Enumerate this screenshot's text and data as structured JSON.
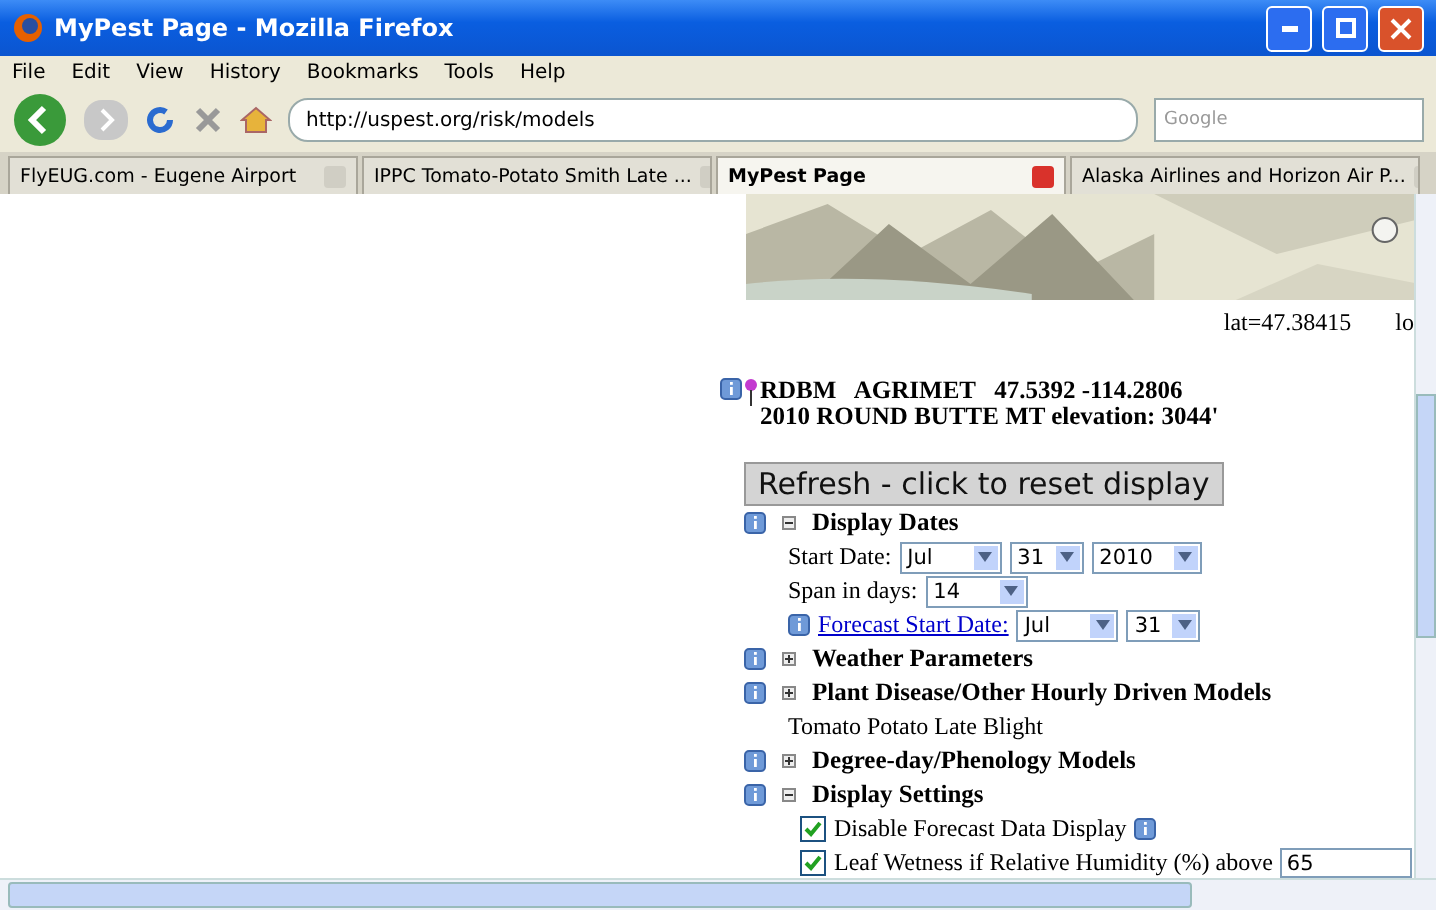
{
  "window": {
    "title": "MyPest Page - Mozilla Firefox"
  },
  "menu": [
    "File",
    "Edit",
    "View",
    "History",
    "Bookmarks",
    "Tools",
    "Help"
  ],
  "address": {
    "value": "http://uspest.org/risk/models"
  },
  "search": {
    "placeholder": "Google"
  },
  "tabs": [
    {
      "label": "FlyEUG.com - Eugene Airport",
      "selected": false
    },
    {
      "label": "IPPC Tomato-Potato Smith Late ...",
      "selected": false
    },
    {
      "label": "MyPest Page",
      "selected": true
    },
    {
      "label": "Alaska Airlines and Horizon Air P...",
      "selected": false
    }
  ],
  "coords": {
    "lat": "lat=47.38415",
    "lon": "lo"
  },
  "station": {
    "line1": "RDBM   AGRIMET   47.5392 -114.2806",
    "line2": "2010 ROUND BUTTE MT elevation: 3044'"
  },
  "refresh_button": "Refresh - click to reset display",
  "sections": [
    {
      "title": "Display Dates",
      "expanded": true,
      "rows": [
        {
          "kind": "selects",
          "label": "Start Date:",
          "selects": [
            "Jul",
            "31",
            "2010"
          ]
        },
        {
          "kind": "selects",
          "label": "Span in days:",
          "selects": [
            "14"
          ]
        },
        {
          "kind": "link",
          "label": "Forecast Start Date:",
          "selects": [
            "Jul",
            "31"
          ]
        }
      ]
    },
    {
      "title": "Weather Parameters",
      "expanded": false
    },
    {
      "title": "Plant Disease/Other Hourly Driven Models",
      "expanded": false,
      "rows": [
        {
          "kind": "text",
          "label": "Tomato Potato Late Blight"
        }
      ]
    },
    {
      "title": "Degree-day/Phenology Models",
      "expanded": false
    },
    {
      "title": "Display Settings",
      "expanded": true,
      "rows": [
        {
          "kind": "checkbox",
          "label": "Disable Forecast Data Display",
          "checked": true,
          "info": true
        },
        {
          "kind": "checkbox",
          "label": "Leaf Wetness if Relative Humidity (%) above",
          "checked": true,
          "value": "65"
        }
      ]
    }
  ]
}
